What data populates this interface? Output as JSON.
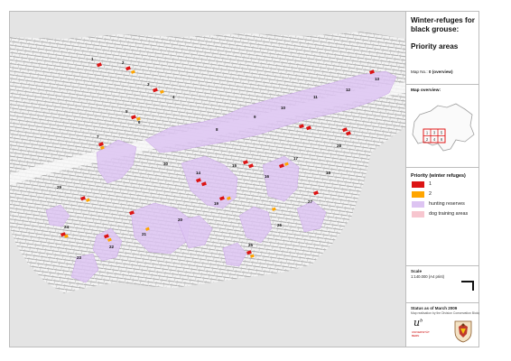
{
  "map": {
    "background_color": "#e4e4e4",
    "relief_color": "#fafafa",
    "hunting_reserve_color": "#ddc4f2",
    "priority1_color": "#dc1414",
    "priority2_color": "#ffa500",
    "area_numbers": [
      "1",
      "2",
      "3",
      "4",
      "5",
      "6",
      "7",
      "8",
      "9",
      "10",
      "11",
      "12",
      "13",
      "14",
      "15",
      "16",
      "17",
      "18",
      "19",
      "20",
      "21",
      "22",
      "23",
      "24",
      "25",
      "26",
      "27",
      "28",
      "29",
      "30"
    ]
  },
  "sidebar": {
    "title": "Winter-refuges for black grouse:",
    "subtitle": "Priority areas",
    "map_no_label": "Map No.:",
    "map_no_value": "0 (overview)",
    "overview_label": "Map overview:",
    "overview_cells": [
      "1",
      "3",
      "5",
      "2",
      "4",
      "6"
    ],
    "legend_title": "Priority (winter refuges)",
    "legend": [
      {
        "label": "1",
        "color": "#dc1414"
      },
      {
        "label": "2",
        "color": "#ffa500"
      },
      {
        "label": "hunting reserves",
        "color": "#ddc4f2"
      },
      {
        "label": "dog training areas",
        "color": "#f7c6cf"
      }
    ],
    "scale_label": "Scale",
    "scale_value": "1:140.000  (A4 print)",
    "status": "Status as of March 2009",
    "credit": "Map realisation by the Division Conservation Biology, University of Bern",
    "logo": "u",
    "logo_sup": "b",
    "university": "UNIVERSITÄT BERN"
  }
}
